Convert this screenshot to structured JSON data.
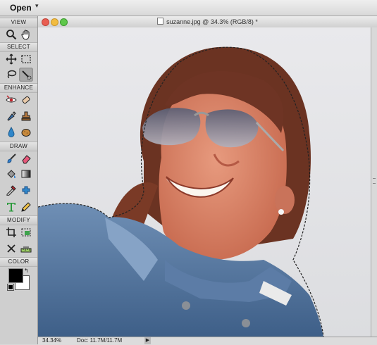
{
  "menubar": {
    "open_label": "Open",
    "open_caret": "▾"
  },
  "toolbox": {
    "sections": {
      "view": "VIEW",
      "select": "SELECT",
      "enhance": "ENHANCE",
      "draw": "DRAW",
      "modify": "MODIFY",
      "color": "COLOR"
    },
    "tools": [
      "zoom-tool-icon",
      "hand-tool-icon",
      "move-tool-icon",
      "marquee-tool-icon",
      "lasso-tool-icon",
      "quick-selection-tool-icon",
      "red-eye-tool-icon",
      "spot-healing-brush-icon",
      "sharpen-tool-icon",
      "clone-stamp-icon",
      "blur-tool-icon",
      "sponge-tool-icon",
      "brush-tool-icon",
      "eraser-tool-icon",
      "paint-bucket-icon",
      "gradient-tool-icon",
      "eyedropper-icon",
      "custom-shape-icon",
      "type-tool-icon",
      "pencil-tool-icon",
      "crop-tool-icon",
      "recompose-tool-icon",
      "content-aware-move-icon",
      "straighten-tool-icon"
    ],
    "active_tool": "quick-selection-tool-icon",
    "foreground_color": "#000000",
    "background_color": "#ffffff"
  },
  "document": {
    "title": "suzanne.jpg @ 34.3% (RGB/8) *",
    "zoom": "34.34%",
    "doc_size": "Doc: 11.7M/11.7M",
    "status_arrow": "▶"
  },
  "colors": {
    "close_light": "#e95e52",
    "minimize_light": "#f2bc40",
    "zoom_light": "#5fc84b",
    "canvas_bg": "#e3e3e6"
  }
}
